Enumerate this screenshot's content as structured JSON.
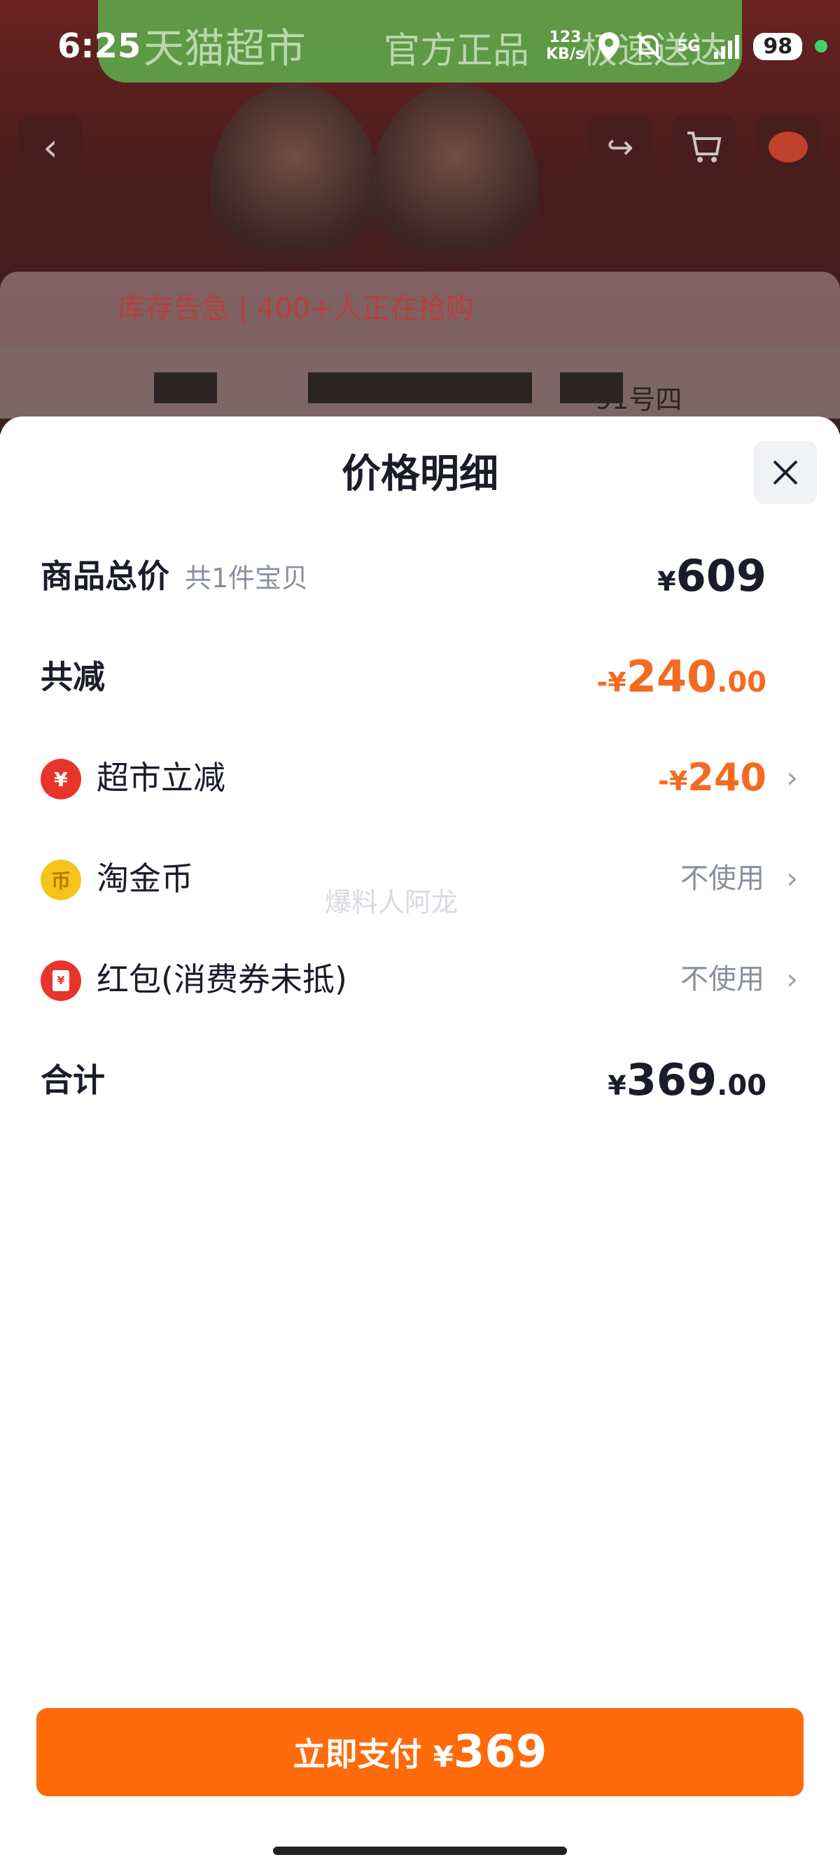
{
  "status_bar": {
    "time": "6:25",
    "net_speed_value": "123",
    "net_speed_unit": "KB/s",
    "network": "5G",
    "battery": "98",
    "icons": [
      "location-icon",
      "bell-muted-icon",
      "signal-icon",
      "battery-icon"
    ]
  },
  "background": {
    "banner_brand": "天猫超市",
    "banner_slogan": "官方正品",
    "banner_suffix": "极速送达",
    "stock_alert": "库存告急 | 400+人正在抢购",
    "address_fragment": "91号四"
  },
  "sheet": {
    "title": "价格明细",
    "close_icon": "close-icon",
    "rows": {
      "total": {
        "label": "商品总价",
        "sub": "共1件宝贝",
        "yen": "¥",
        "amount": "609"
      },
      "reduce": {
        "label": "共减",
        "prefix": "-¥",
        "amount": "240",
        "cents": ".00"
      },
      "market": {
        "label": "超市立减",
        "prefix": "-¥",
        "amount": "240",
        "icon": "yen-circle-icon"
      },
      "coin": {
        "label": "淘金币",
        "value": "不使用",
        "icon": "coin-icon"
      },
      "redpacket": {
        "label": "红包(消费券未抵)",
        "value": "不使用",
        "icon": "red-packet-icon"
      },
      "sum": {
        "label": "合计",
        "yen": "¥",
        "amount": "369",
        "cents": ".00"
      }
    },
    "watermark": "爆料人阿龙"
  },
  "pay_button": {
    "label": "立即支付",
    "yen": "¥",
    "amount": "369"
  },
  "colors": {
    "accent": "#ff6a0a",
    "discount": "#f26b21",
    "text": "#1a1c2a",
    "muted": "#8a8f9e"
  }
}
